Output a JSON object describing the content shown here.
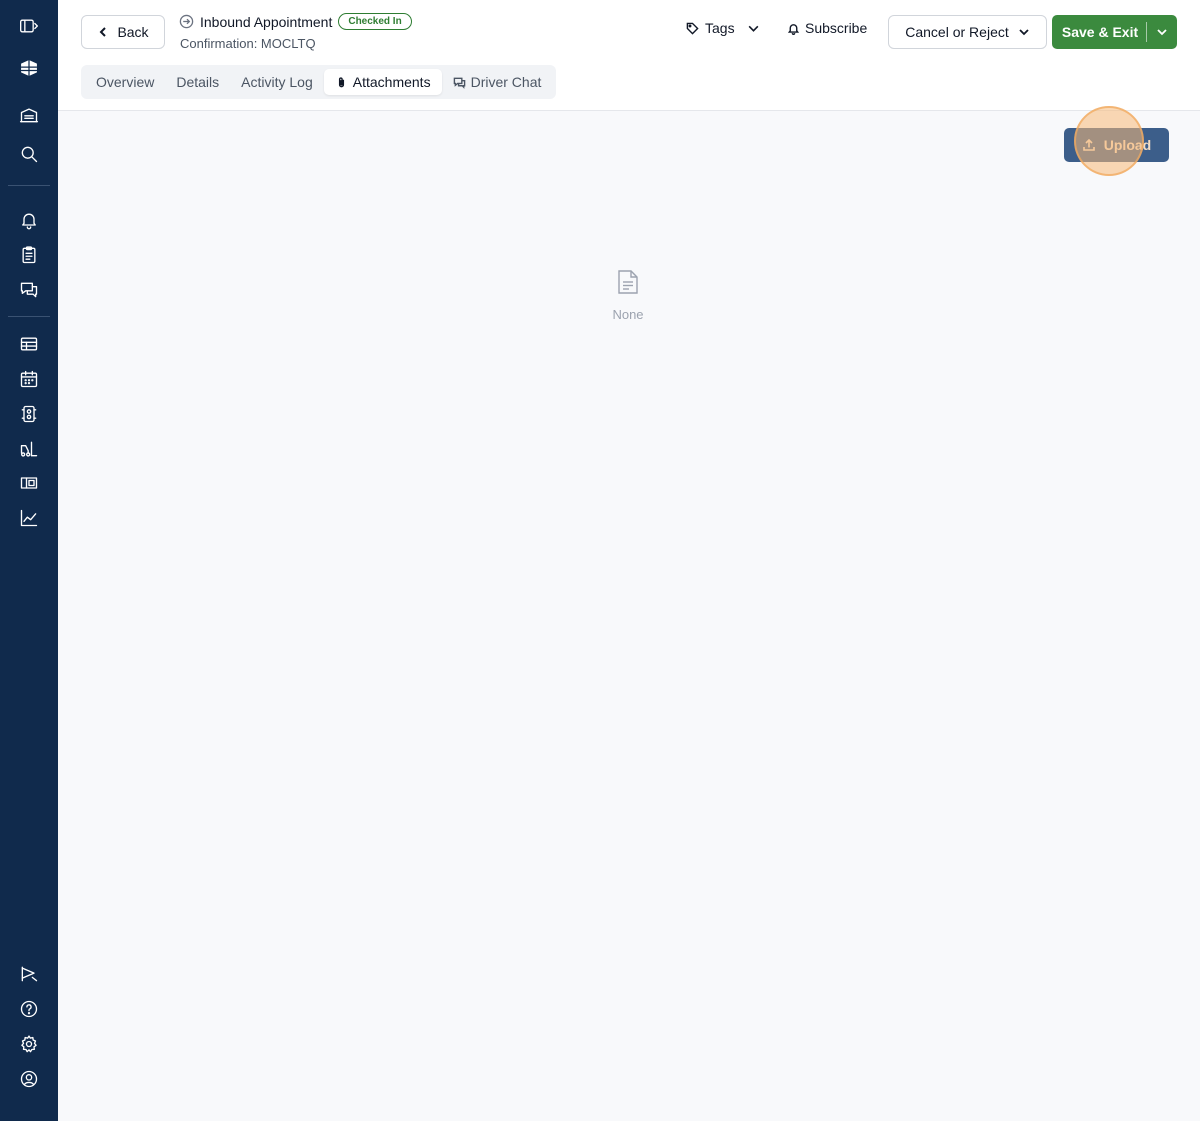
{
  "sidebar": {
    "icons": [
      "sidebar-toggle-icon",
      "logo-icon",
      "warehouse-icon",
      "search-icon",
      "bell-icon",
      "clipboard-icon",
      "chat-icon",
      "appointments-icon",
      "calendar-icon",
      "dock-icon",
      "forklift-icon",
      "yard-icon",
      "analytics-icon",
      "whats-new-icon",
      "help-icon",
      "settings-icon",
      "profile-icon"
    ]
  },
  "header": {
    "back_label": "Back",
    "title": "Inbound Appointment",
    "status": "Checked In",
    "confirmation": "Confirmation: MOCLTQ",
    "tags_label": "Tags",
    "subscribe_label": "Subscribe",
    "cancel_label": "Cancel or Reject",
    "save_label": "Save & Exit"
  },
  "tabs": [
    {
      "label": "Overview"
    },
    {
      "label": "Details"
    },
    {
      "label": "Activity Log"
    },
    {
      "label": "Attachments",
      "active": true
    },
    {
      "label": "Driver Chat"
    }
  ],
  "main": {
    "upload_label": "Upload",
    "empty_label": "None"
  },
  "colors": {
    "sidebar_bg": "#102a4c",
    "save_green": "#3b8a3e",
    "upload_blue": "#3c5e8a",
    "status_green": "#2e7d32"
  }
}
